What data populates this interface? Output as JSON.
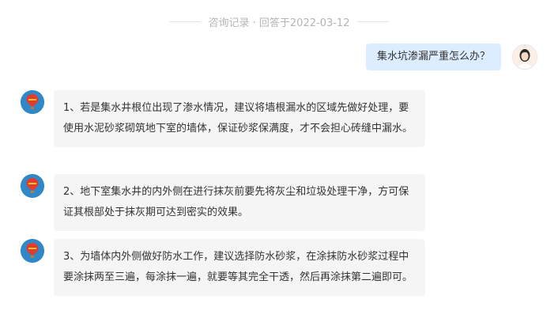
{
  "header": {
    "text": "咨询记录 · 回答于2022-03-12"
  },
  "question": {
    "text": "集水坑渗漏严重怎么办？"
  },
  "answers": [
    {
      "text": "1、若是集水井根位出现了渗水情况，建议将墙根漏水的区域先做好处理，要使用水泥砂浆砌筑地下室的墙体，保证砂浆保满度，才不会担心砖缝中漏水。"
    },
    {
      "text": "2、地下室集水井的内外侧在进行抹灰前要先将灰尘和垃圾处理干净，方可保证其根部处于抹灰期可达到密实的效果。"
    },
    {
      "text": "3、为墙体内外侧做好防水工作，建议选择防水砂浆，在涂抹防水砂浆过程中要涂抹两至三遍，每涂抹一遍，就要等其完全干透，然后再涂抹第二遍即可。"
    }
  ],
  "icons": {
    "user_avatar": "user-avatar-photo",
    "bot_avatar": "hot-air-balloon-avatar"
  },
  "colors": {
    "question_bubble": "#dcedff",
    "answer_bubble": "#f5f5f5",
    "bot_avatar_bg": "#2f88c8"
  }
}
